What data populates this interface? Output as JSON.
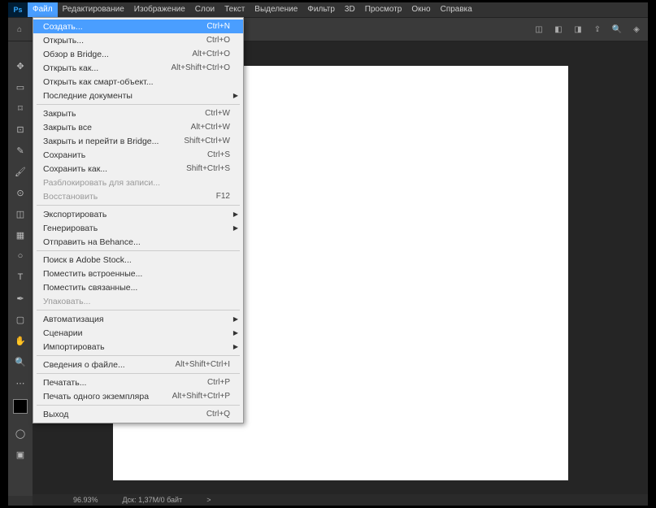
{
  "logo": "Ps",
  "menubar": [
    "Файл",
    "Редактирование",
    "Изображение",
    "Слои",
    "Текст",
    "Выделение",
    "Фильтр",
    "3D",
    "Просмотр",
    "Окно",
    "Справка"
  ],
  "active_menu_index": 0,
  "dropdown": {
    "groups": [
      [
        {
          "label": "Создать...",
          "shortcut": "Ctrl+N",
          "highlighted": true
        },
        {
          "label": "Открыть...",
          "shortcut": "Ctrl+O"
        },
        {
          "label": "Обзор в Bridge...",
          "shortcut": "Alt+Ctrl+O"
        },
        {
          "label": "Открыть как...",
          "shortcut": "Alt+Shift+Ctrl+O"
        },
        {
          "label": "Открыть как смарт-объект..."
        },
        {
          "label": "Последние документы",
          "submenu": true
        }
      ],
      [
        {
          "label": "Закрыть",
          "shortcut": "Ctrl+W"
        },
        {
          "label": "Закрыть все",
          "shortcut": "Alt+Ctrl+W"
        },
        {
          "label": "Закрыть и перейти в Bridge...",
          "shortcut": "Shift+Ctrl+W"
        },
        {
          "label": "Сохранить",
          "shortcut": "Ctrl+S"
        },
        {
          "label": "Сохранить как...",
          "shortcut": "Shift+Ctrl+S"
        },
        {
          "label": "Разблокировать для записи...",
          "disabled": true
        },
        {
          "label": "Восстановить",
          "shortcut": "F12",
          "disabled": true
        }
      ],
      [
        {
          "label": "Экспортировать",
          "submenu": true
        },
        {
          "label": "Генерировать",
          "submenu": true
        },
        {
          "label": "Отправить на Behance..."
        }
      ],
      [
        {
          "label": "Поиск в Adobe Stock..."
        },
        {
          "label": "Поместить встроенные..."
        },
        {
          "label": "Поместить связанные..."
        },
        {
          "label": "Упаковать...",
          "disabled": true
        }
      ],
      [
        {
          "label": "Автоматизация",
          "submenu": true
        },
        {
          "label": "Сценарии",
          "submenu": true
        },
        {
          "label": "Импортировать",
          "submenu": true
        }
      ],
      [
        {
          "label": "Сведения о файле...",
          "shortcut": "Alt+Shift+Ctrl+I"
        }
      ],
      [
        {
          "label": "Печатать...",
          "shortcut": "Ctrl+P"
        },
        {
          "label": "Печать одного экземпляра",
          "shortcut": "Alt+Shift+Ctrl+P"
        }
      ],
      [
        {
          "label": "Выход",
          "shortcut": "Ctrl+Q"
        }
      ]
    ]
  },
  "status": {
    "zoom": "96.93%",
    "doc": "Дск: 1,37M/0 байт",
    "arrow": ">"
  }
}
